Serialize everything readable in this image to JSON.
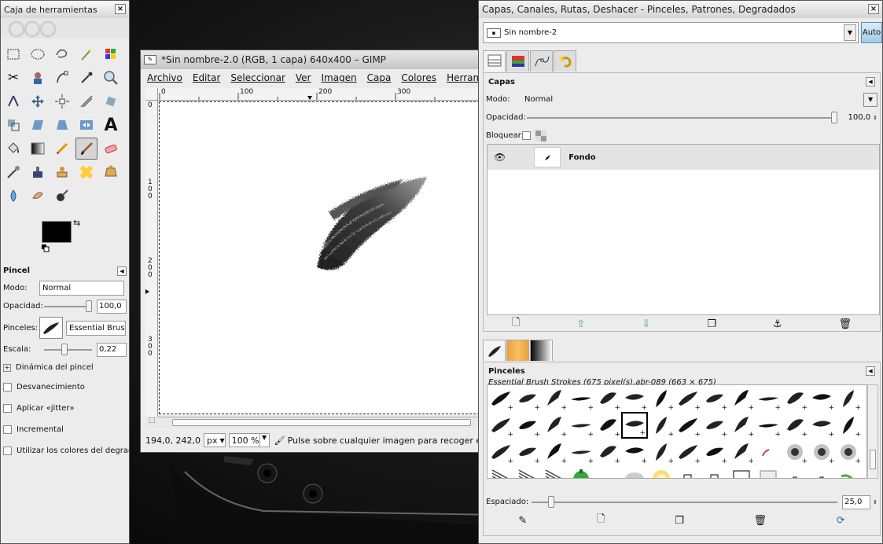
{
  "toolbox": {
    "title": "Caja de herramientas",
    "options": {
      "header": "Pincel",
      "mode_label": "Modo:",
      "mode_value": "Normal",
      "opacity_label": "Opacidad:",
      "opacity_value": "100,0",
      "opacity_fraction": 1.0,
      "brushes_label": "Pinceles:",
      "brush_name": "Essential Brush S",
      "scale_label": "Escala:",
      "scale_value": "0,22",
      "dynamics_label": "Dinámica del pincel",
      "checks": [
        "Desvanecimiento",
        "Aplicar «jitter»",
        "Incremental",
        "Utilizar los colores del degradado"
      ]
    },
    "colors": {
      "fg": "#000000",
      "bg": "#ffffff"
    }
  },
  "image_window": {
    "title": "*Sin nombre-2.0 (RGB, 1 capa) 640x400 – GIMP",
    "menus": [
      "Archivo",
      "Editar",
      "Seleccionar",
      "Ver",
      "Imagen",
      "Capa",
      "Colores",
      "Herramientas"
    ],
    "hruler_labels": [
      "0",
      "100",
      "200",
      "300"
    ],
    "vruler_labels": [
      "0",
      "100",
      "200",
      "300"
    ],
    "status": {
      "coords": "194,0, 242,0",
      "unit": "px",
      "zoom": "100 %",
      "message": "Pulse sobre cualquier imagen para recoger el"
    }
  },
  "dock": {
    "title": "Capas, Canales, Rutas, Deshacer - Pinceles, Patrones, Degradados",
    "image_name": "Sin nombre-2",
    "auto_label": "Auto",
    "layers": {
      "header": "Capas",
      "mode_label": "Modo:",
      "mode_value": "Normal",
      "opacity_label": "Opacidad:",
      "opacity_value": "100,0",
      "lock_label": "Bloquear:",
      "layer_name": "Fondo"
    },
    "brushes": {
      "header": "Pinceles",
      "info": "Essential Brush Strokes (675 pixel(s).abr-089 (663 × 675)",
      "spacing_label": "Espaciado:",
      "spacing_value": "25,0",
      "spacing_fraction": 0.25
    }
  }
}
